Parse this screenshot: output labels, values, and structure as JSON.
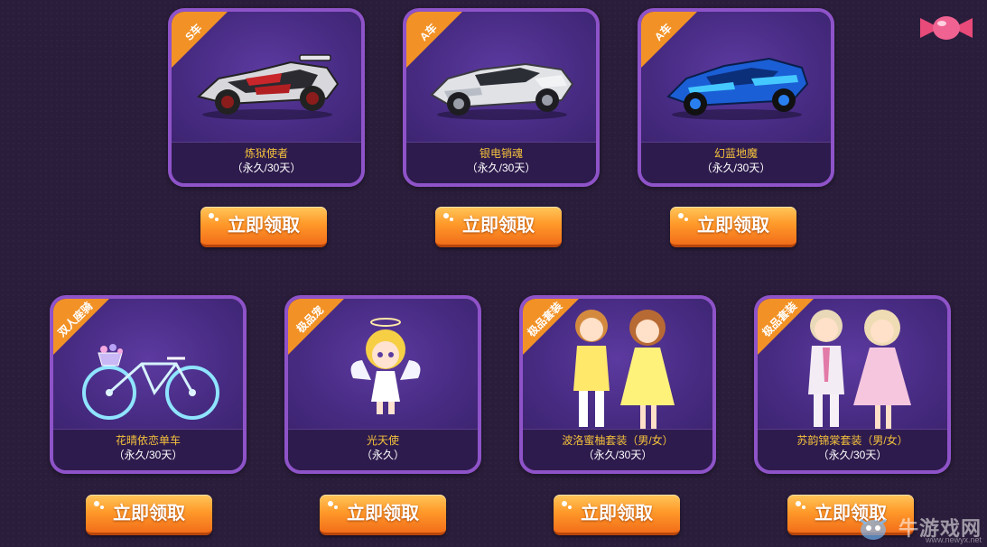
{
  "rewards": [
    {
      "tag": "S车",
      "name": "炼狱使者",
      "duration": "（永久/30天）",
      "button": "立即领取"
    },
    {
      "tag": "A车",
      "name": "银电销魂",
      "duration": "（永久/30天）",
      "button": "立即领取"
    },
    {
      "tag": "A车",
      "name": "幻蓝地魔",
      "duration": "（永久/30天）",
      "button": "立即领取"
    },
    {
      "tag": "双人座骑",
      "name": "花晴依恋单车",
      "duration": "（永久/30天）",
      "button": "立即领取"
    },
    {
      "tag": "极品宠",
      "name": "光天使",
      "duration": "（永久）",
      "button": "立即领取"
    },
    {
      "tag": "极品套装",
      "name": "波洛蜜柚套装（男/女）",
      "duration": "（永久/30天）",
      "button": "立即领取"
    },
    {
      "tag": "极品套装",
      "name": "苏韵锦棠套装（男/女）",
      "duration": "（永久/30天）",
      "button": "立即领取"
    }
  ],
  "watermark": {
    "title": "牛游戏网",
    "url": "www.newyx.net"
  },
  "colors": {
    "background": "#2a1d3b",
    "card_border": "#8e53c8",
    "ribbon": "#f29226",
    "name_text": "#f5c23c",
    "button": "#ff9a2a"
  },
  "icons": [
    "candy-icon",
    "mascot-icon"
  ]
}
